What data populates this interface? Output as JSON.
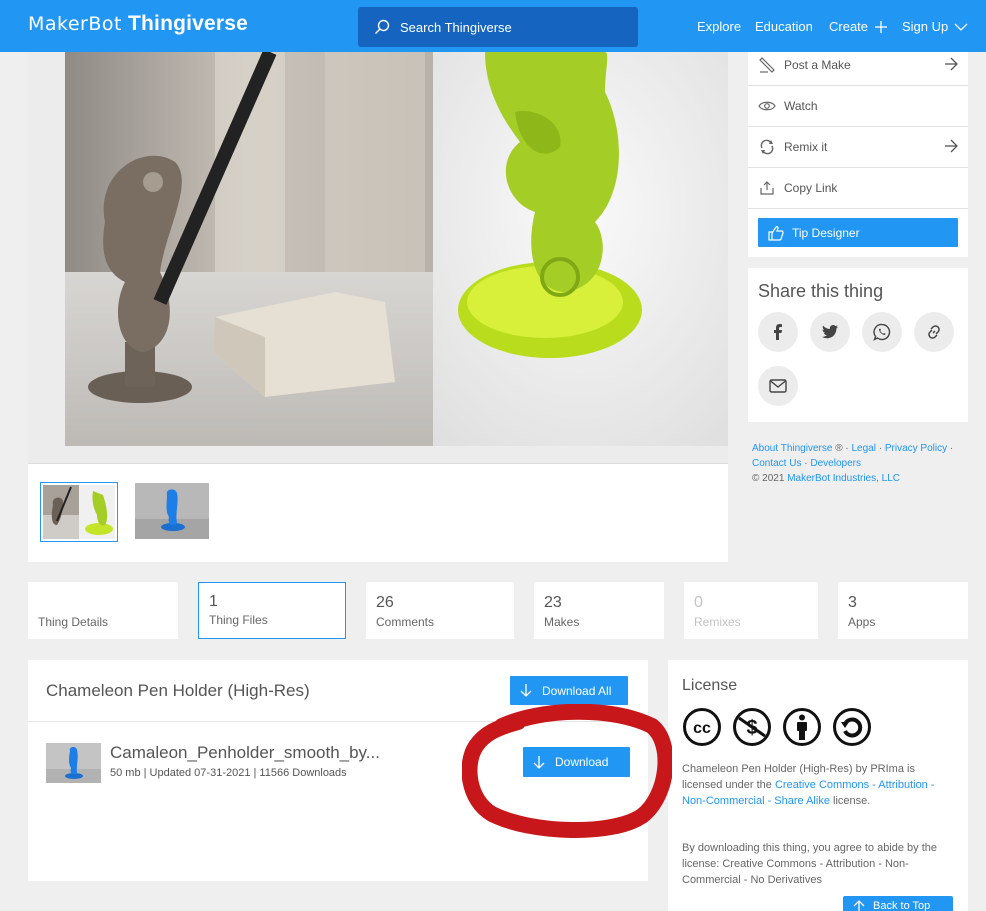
{
  "header": {
    "logo_brand": "MakerBot",
    "logo_product": "Thingiverse",
    "search_placeholder": "Search Thingiverse",
    "nav": [
      "Explore",
      "Education",
      "Create",
      "Sign Up"
    ]
  },
  "actions": {
    "items": [
      "Post a Make",
      "Watch",
      "Remix it",
      "Copy Link"
    ],
    "tip_button": "Tip Designer"
  },
  "share": {
    "title": "Share this thing",
    "buttons": [
      "facebook-icon",
      "twitter-icon",
      "whatsapp-icon",
      "link-icon",
      "mail-icon"
    ]
  },
  "footer": {
    "about": "About Thingiverse",
    "registered": "®",
    "legal": "Legal",
    "privacy": "Privacy Policy",
    "contact": "Contact Us",
    "developers": "Developers",
    "copyright_prefix": "©  2021",
    "company": "MakerBot Industries, LLC",
    "separator": "·"
  },
  "tabs": [
    {
      "count": "",
      "label": "Thing Details"
    },
    {
      "count": "1",
      "label": "Thing Files"
    },
    {
      "count": "26",
      "label": "Comments"
    },
    {
      "count": "23",
      "label": "Makes"
    },
    {
      "count": "0",
      "label": "Remixes"
    },
    {
      "count": "3",
      "label": "Apps"
    }
  ],
  "files": {
    "title": "Chameleon Pen Holder (High-Res)",
    "download_all": "Download All",
    "file_name": "Camaleon_Penholder_smooth_by...",
    "file_meta": "50 mb | Updated 07-31-2021 | 11566 Downloads",
    "download": "Download"
  },
  "license": {
    "title": "License",
    "thing": "Chameleon Pen Holder (High-Res)",
    "by": "by",
    "author": "PRIma",
    "is_licensed": "is licensed under the",
    "license_name": "Creative Commons - Attribution - Non-Commercial - Share Alike",
    "suffix": "license.",
    "note": "By downloading this thing, you agree to abide by the license: Creative Commons - Attribution - Non-Commercial - No Derivatives"
  },
  "back_to_top": "Back to Top",
  "colors": {
    "brand_blue": "#2196f3",
    "search_bg": "#1565c0",
    "annotation_red": "#c8171a"
  }
}
